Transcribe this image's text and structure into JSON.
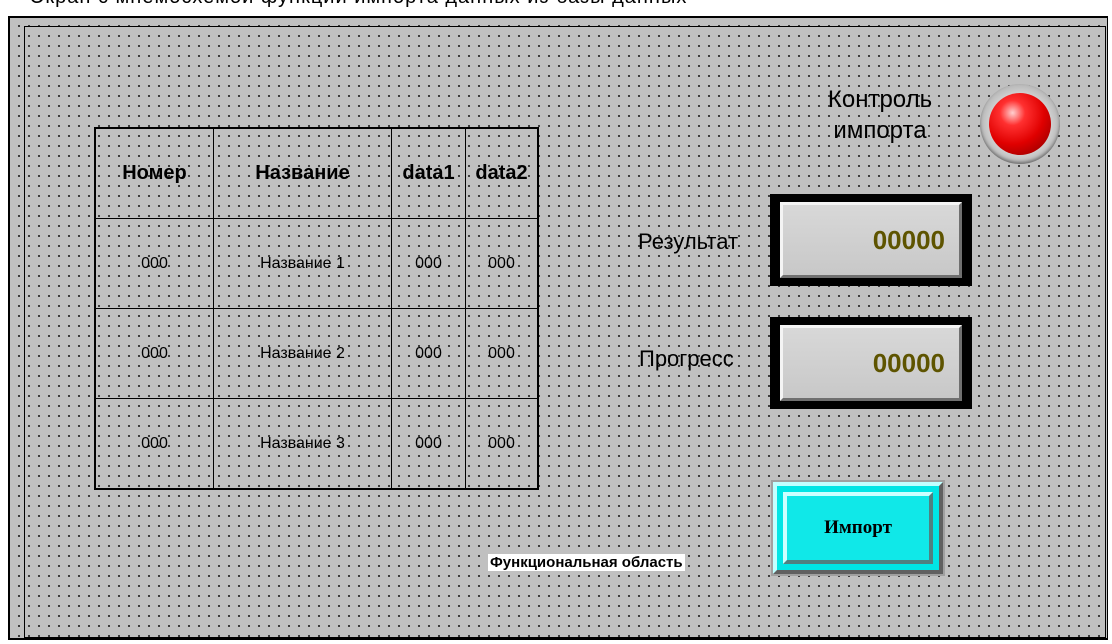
{
  "top_caption": "Экран с мнемосхемой функции импорта данных из базы данных",
  "table": {
    "headers": [
      "Номер",
      "Название",
      "data1",
      "data2"
    ],
    "rows": [
      [
        "000",
        "Название 1",
        "000",
        "000"
      ],
      [
        "000",
        "Название 2",
        "000",
        "000"
      ],
      [
        "000",
        "Название 3",
        "000",
        "000"
      ]
    ]
  },
  "status": {
    "control_label_line1": "Контроль",
    "control_label_line2": "импорта",
    "indicator_color": "#ff0000"
  },
  "result": {
    "label": "Результат",
    "value": "00000"
  },
  "progress": {
    "label": "Прогресс",
    "value": "00000"
  },
  "import_button": {
    "label": "Импорт",
    "color": "#00e5e5"
  },
  "function_area_label": "Функциональная область"
}
